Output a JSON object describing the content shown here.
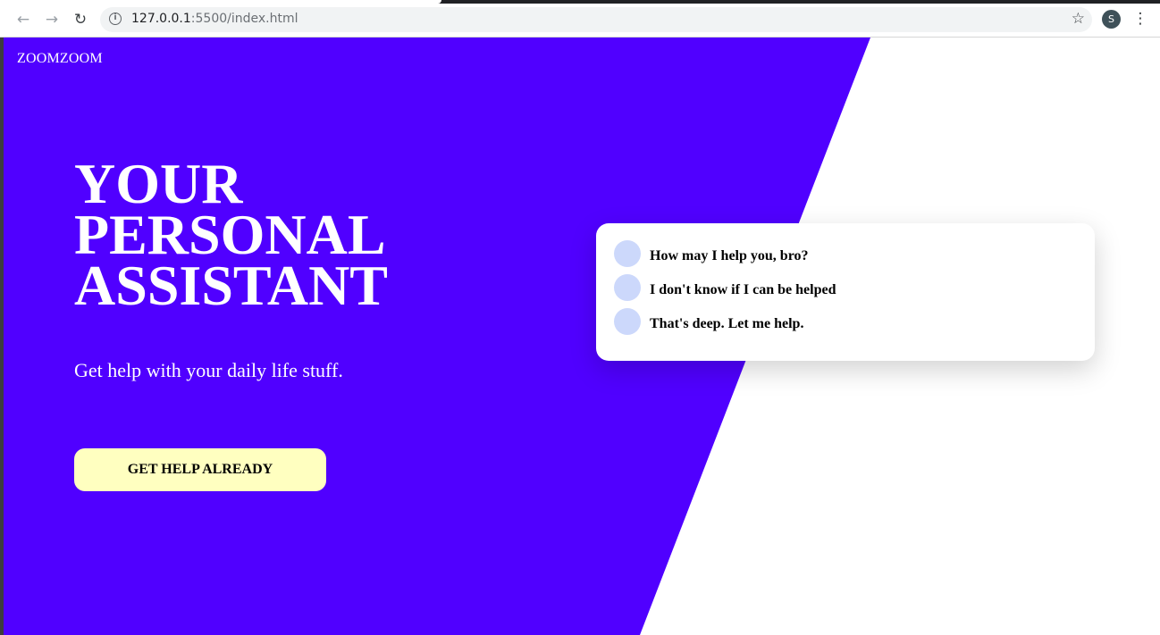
{
  "browser": {
    "url_host": "127.0.0.1",
    "url_rest": ":5500/index.html",
    "profile_initial": "S",
    "icons": {
      "back": "back-arrow-icon",
      "forward": "forward-arrow-icon",
      "reload": "reload-icon",
      "info": "info-icon",
      "star": "star-icon",
      "menu": "kebab-menu-icon"
    }
  },
  "site": {
    "brand": "ZOOMZOOM",
    "headline": [
      "YOUR",
      "PERSONAL",
      "ASSISTANT"
    ],
    "subtitle": "Get help with your daily life stuff.",
    "cta_label": "GET HELP ALREADY",
    "chat": [
      {
        "text": "How may I help you, bro?"
      },
      {
        "text": "I don't know if I can be helped"
      },
      {
        "text": "That's deep. Let me help."
      }
    ],
    "colors": {
      "hero": "#5000ff",
      "cta": "#ffffc0",
      "chat_avatar": "#ccd8fb",
      "background": "#ffffff"
    }
  }
}
